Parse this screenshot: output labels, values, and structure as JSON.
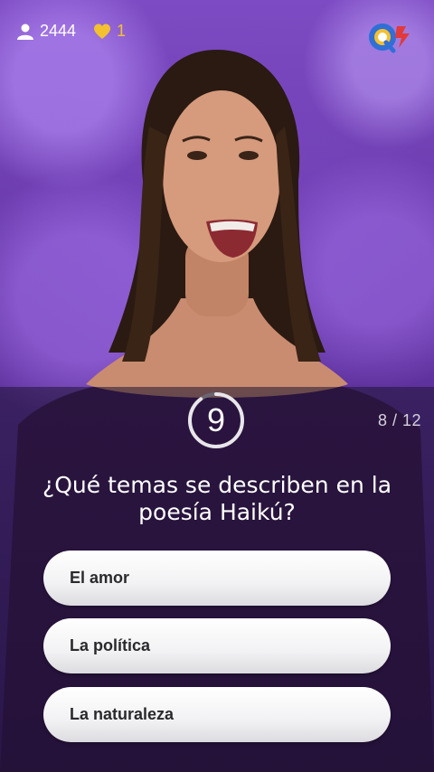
{
  "header": {
    "players_count": "2444",
    "lives_count": "1",
    "players_icon": "user-icon",
    "lives_icon": "heart-icon",
    "logo_icon": "q12-logo"
  },
  "timer": {
    "value": "9",
    "remaining_fraction": 0.9
  },
  "progress": {
    "text": "8 / 12"
  },
  "question": {
    "text": "¿Qué temas se describen en la poesía Haikú?"
  },
  "answers": [
    {
      "label": "El amor"
    },
    {
      "label": "La política"
    },
    {
      "label": "La naturaleza"
    }
  ],
  "colors": {
    "background_purple": "#6a3aad",
    "lives_yellow": "#f3c030",
    "logo_blue": "#2f6fd6",
    "logo_red": "#e03a3a",
    "logo_yellow": "#f3c030"
  }
}
